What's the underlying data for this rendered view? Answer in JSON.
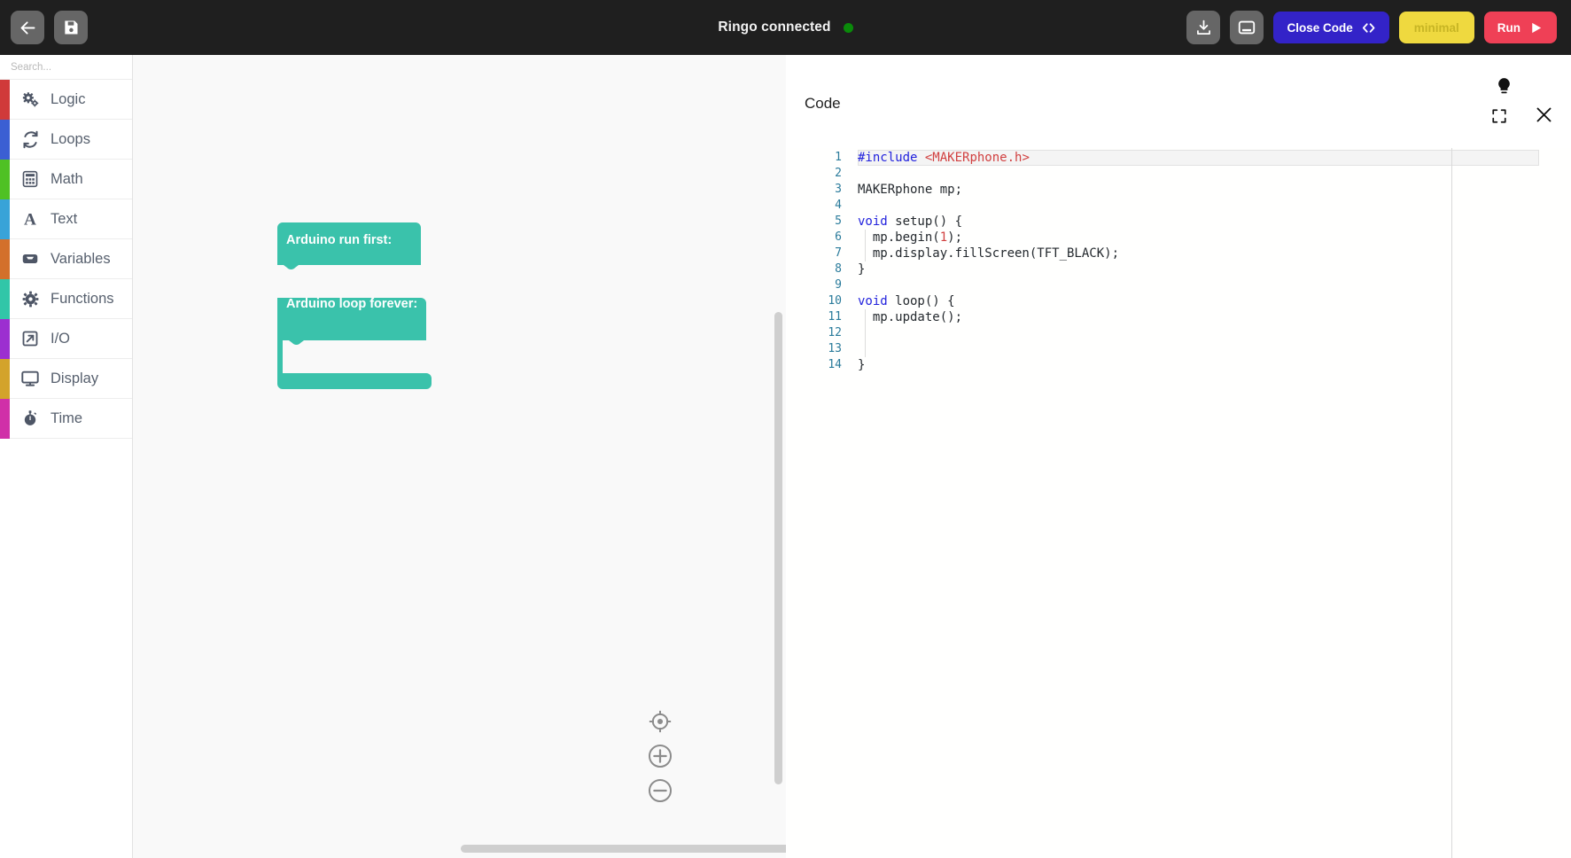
{
  "topbar": {
    "back_icon": "arrow-left-icon",
    "save_icon": "save-disk-icon",
    "connection_label": "Ringo connected",
    "connection_status_color": "#0a8a0a",
    "download_icon": "download-icon",
    "layout_icon": "panel-layout-icon",
    "close_code_label": "Close Code",
    "close_code_color": "#3323c8",
    "minimal_label": "minimal",
    "minimal_color": "#efd93f",
    "run_label": "Run",
    "run_color": "#ef4056"
  },
  "sidebar": {
    "search_placeholder": "Search...",
    "search_value": "",
    "search_icon": "search-icon",
    "items": [
      {
        "label": "Logic",
        "color": "#d03a3a",
        "icon": "gears-icon"
      },
      {
        "label": "Loops",
        "color": "#3b5fd3",
        "icon": "loop-refresh-icon"
      },
      {
        "label": "Math",
        "color": "#4fc124",
        "icon": "calculator-icon"
      },
      {
        "label": "Text",
        "color": "#38a3d8",
        "icon": "letter-a-icon"
      },
      {
        "label": "Variables",
        "color": "#d3702b",
        "icon": "inbox-tray-icon"
      },
      {
        "label": "Functions",
        "color": "#31c6a8",
        "icon": "gear-icon"
      },
      {
        "label": "I/O",
        "color": "#9c2fd0",
        "icon": "arrow-out-square-icon"
      },
      {
        "label": "Display",
        "color": "#d3a32b",
        "icon": "monitor-icon"
      },
      {
        "label": "Time",
        "color": "#d030a8",
        "icon": "stopwatch-icon"
      }
    ]
  },
  "canvas": {
    "block_color": "#3ac2ab",
    "blocks": [
      {
        "label": "Arduino run first:"
      },
      {
        "label": "Arduino loop forever:"
      }
    ],
    "center_icon": "crosshair-target-icon",
    "zoom_in_icon": "plus-circle-icon",
    "zoom_out_icon": "minus-circle-icon",
    "vscroll": "vertical-scrollbar",
    "hscroll": "horizontal-scrollbar"
  },
  "code_panel": {
    "title": "Code",
    "bulb_icon": "lightbulb-icon",
    "expand_icon": "fullscreen-expand-icon",
    "close_icon": "close-x-icon",
    "lines": [
      {
        "n": "1",
        "code": "#include <MAKERphone.h>"
      },
      {
        "n": "2",
        "code": ""
      },
      {
        "n": "3",
        "code": "MAKERphone mp;"
      },
      {
        "n": "4",
        "code": ""
      },
      {
        "n": "5",
        "code": "void setup() {"
      },
      {
        "n": "6",
        "code": "  mp.begin(1);"
      },
      {
        "n": "7",
        "code": "  mp.display.fillScreen(TFT_BLACK);"
      },
      {
        "n": "8",
        "code": "}"
      },
      {
        "n": "9",
        "code": ""
      },
      {
        "n": "10",
        "code": "void loop() {"
      },
      {
        "n": "11",
        "code": "  mp.update();"
      },
      {
        "n": "12",
        "code": ""
      },
      {
        "n": "13",
        "code": ""
      },
      {
        "n": "14",
        "code": "}"
      }
    ]
  }
}
